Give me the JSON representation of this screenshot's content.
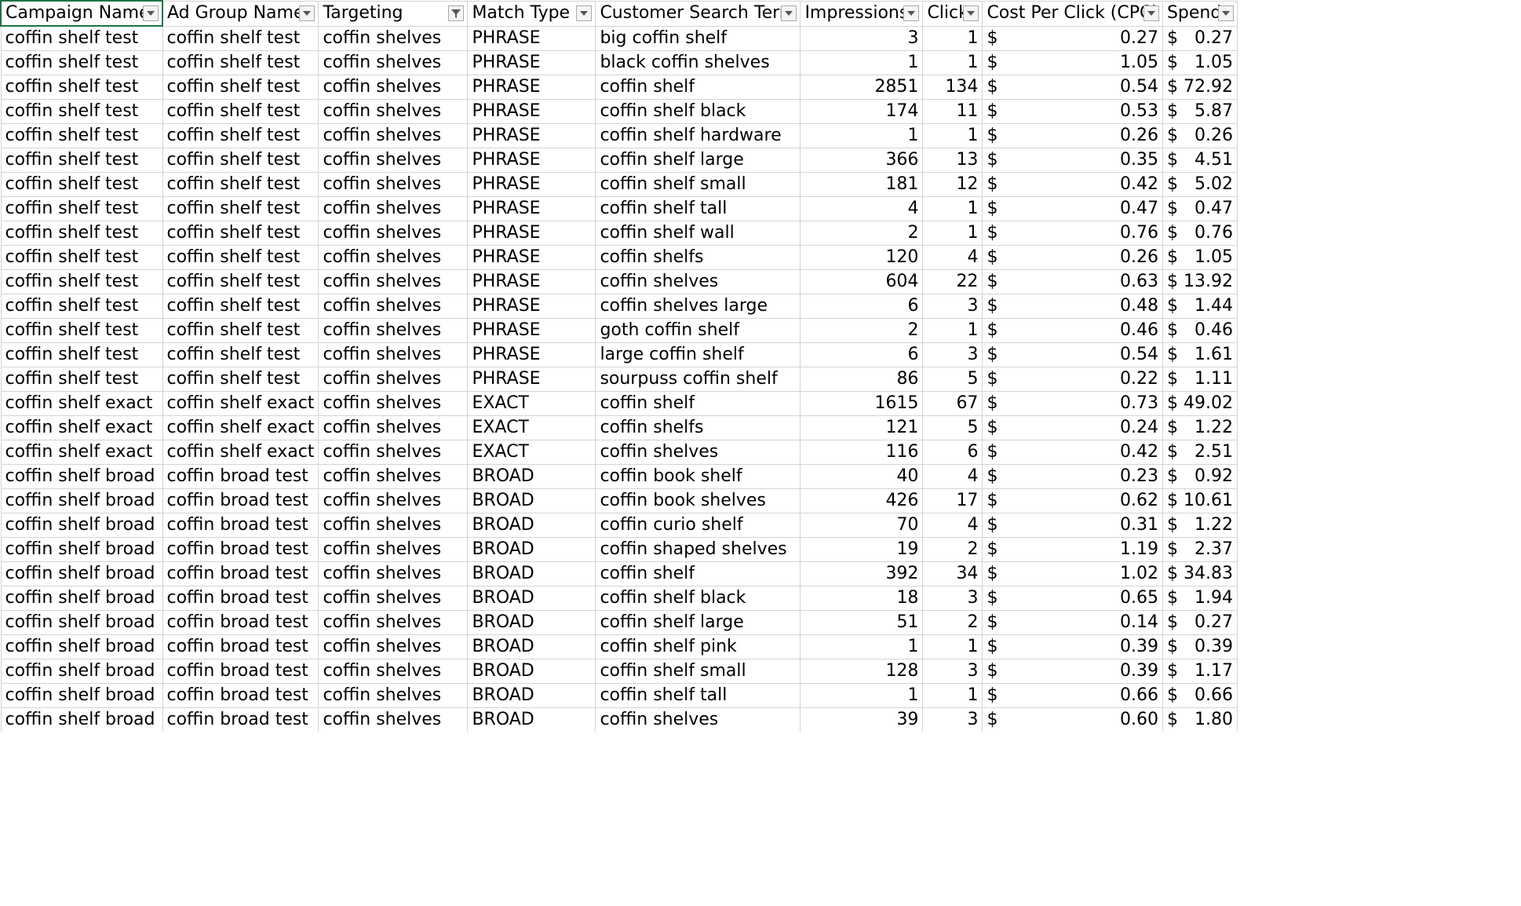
{
  "columns": [
    {
      "label": "Campaign Name",
      "filter": "dropdown"
    },
    {
      "label": "Ad Group Name",
      "filter": "dropdown"
    },
    {
      "label": "Targeting",
      "filter": "funnel"
    },
    {
      "label": "Match Type",
      "filter": "dropdown"
    },
    {
      "label": "Customer Search Term",
      "filter": "dropdown"
    },
    {
      "label": "Impressions",
      "filter": "dropdown"
    },
    {
      "label": "Click",
      "filter": "dropdown"
    },
    {
      "label": "Cost Per Click (CPC)",
      "filter": "dropdown"
    },
    {
      "label": "Spend",
      "filter": "dropdown"
    }
  ],
  "rows": [
    [
      "coffin shelf test",
      "coffin shelf test",
      "coffin shelves",
      "PHRASE",
      "big coffin shelf",
      "3",
      "1",
      "0.27",
      "0.27"
    ],
    [
      "coffin shelf test",
      "coffin shelf test",
      "coffin shelves",
      "PHRASE",
      "black coffin shelves",
      "1",
      "1",
      "1.05",
      "1.05"
    ],
    [
      "coffin shelf test",
      "coffin shelf test",
      "coffin shelves",
      "PHRASE",
      "coffin shelf",
      "2851",
      "134",
      "0.54",
      "72.92"
    ],
    [
      "coffin shelf test",
      "coffin shelf test",
      "coffin shelves",
      "PHRASE",
      "coffin shelf black",
      "174",
      "11",
      "0.53",
      "5.87"
    ],
    [
      "coffin shelf test",
      "coffin shelf test",
      "coffin shelves",
      "PHRASE",
      "coffin shelf hardware",
      "1",
      "1",
      "0.26",
      "0.26"
    ],
    [
      "coffin shelf test",
      "coffin shelf test",
      "coffin shelves",
      "PHRASE",
      "coffin shelf large",
      "366",
      "13",
      "0.35",
      "4.51"
    ],
    [
      "coffin shelf test",
      "coffin shelf test",
      "coffin shelves",
      "PHRASE",
      "coffin shelf small",
      "181",
      "12",
      "0.42",
      "5.02"
    ],
    [
      "coffin shelf test",
      "coffin shelf test",
      "coffin shelves",
      "PHRASE",
      "coffin shelf tall",
      "4",
      "1",
      "0.47",
      "0.47"
    ],
    [
      "coffin shelf test",
      "coffin shelf test",
      "coffin shelves",
      "PHRASE",
      "coffin shelf wall",
      "2",
      "1",
      "0.76",
      "0.76"
    ],
    [
      "coffin shelf test",
      "coffin shelf test",
      "coffin shelves",
      "PHRASE",
      "coffin shelfs",
      "120",
      "4",
      "0.26",
      "1.05"
    ],
    [
      "coffin shelf test",
      "coffin shelf test",
      "coffin shelves",
      "PHRASE",
      "coffin shelves",
      "604",
      "22",
      "0.63",
      "13.92"
    ],
    [
      "coffin shelf test",
      "coffin shelf test",
      "coffin shelves",
      "PHRASE",
      "coffin shelves large",
      "6",
      "3",
      "0.48",
      "1.44"
    ],
    [
      "coffin shelf test",
      "coffin shelf test",
      "coffin shelves",
      "PHRASE",
      "goth coffin shelf",
      "2",
      "1",
      "0.46",
      "0.46"
    ],
    [
      "coffin shelf test",
      "coffin shelf test",
      "coffin shelves",
      "PHRASE",
      "large coffin shelf",
      "6",
      "3",
      "0.54",
      "1.61"
    ],
    [
      "coffin shelf test",
      "coffin shelf test",
      "coffin shelves",
      "PHRASE",
      "sourpuss coffin shelf",
      "86",
      "5",
      "0.22",
      "1.11"
    ],
    [
      "coffin shelf exact",
      "coffin shelf exact",
      "coffin shelves",
      "EXACT",
      "coffin shelf",
      "1615",
      "67",
      "0.73",
      "49.02"
    ],
    [
      "coffin shelf exact",
      "coffin shelf exact",
      "coffin shelves",
      "EXACT",
      "coffin shelfs",
      "121",
      "5",
      "0.24",
      "1.22"
    ],
    [
      "coffin shelf exact",
      "coffin shelf exact",
      "coffin shelves",
      "EXACT",
      "coffin shelves",
      "116",
      "6",
      "0.42",
      "2.51"
    ],
    [
      "coffin shelf broad",
      "coffin broad test",
      "coffin shelves",
      "BROAD",
      "coffin book shelf",
      "40",
      "4",
      "0.23",
      "0.92"
    ],
    [
      "coffin shelf broad",
      "coffin broad test",
      "coffin shelves",
      "BROAD",
      "coffin book shelves",
      "426",
      "17",
      "0.62",
      "10.61"
    ],
    [
      "coffin shelf broad",
      "coffin broad test",
      "coffin shelves",
      "BROAD",
      "coffin curio shelf",
      "70",
      "4",
      "0.31",
      "1.22"
    ],
    [
      "coffin shelf broad",
      "coffin broad test",
      "coffin shelves",
      "BROAD",
      "coffin shaped shelves",
      "19",
      "2",
      "1.19",
      "2.37"
    ],
    [
      "coffin shelf broad",
      "coffin broad test",
      "coffin shelves",
      "BROAD",
      "coffin shelf",
      "392",
      "34",
      "1.02",
      "34.83"
    ],
    [
      "coffin shelf broad",
      "coffin broad test",
      "coffin shelves",
      "BROAD",
      "coffin shelf black",
      "18",
      "3",
      "0.65",
      "1.94"
    ],
    [
      "coffin shelf broad",
      "coffin broad test",
      "coffin shelves",
      "BROAD",
      "coffin shelf large",
      "51",
      "2",
      "0.14",
      "0.27"
    ],
    [
      "coffin shelf broad",
      "coffin broad test",
      "coffin shelves",
      "BROAD",
      "coffin shelf pink",
      "1",
      "1",
      "0.39",
      "0.39"
    ],
    [
      "coffin shelf broad",
      "coffin broad test",
      "coffin shelves",
      "BROAD",
      "coffin shelf small",
      "128",
      "3",
      "0.39",
      "1.17"
    ],
    [
      "coffin shelf broad",
      "coffin broad test",
      "coffin shelves",
      "BROAD",
      "coffin shelf tall",
      "1",
      "1",
      "0.66",
      "0.66"
    ],
    [
      "coffin shelf broad",
      "coffin broad test",
      "coffin shelves",
      "BROAD",
      "coffin shelves",
      "39",
      "3",
      "0.60",
      "1.80"
    ]
  ],
  "currency_symbol": "$",
  "colors": {
    "selected_border": "#217346",
    "gridline": "#d4d4d4"
  }
}
